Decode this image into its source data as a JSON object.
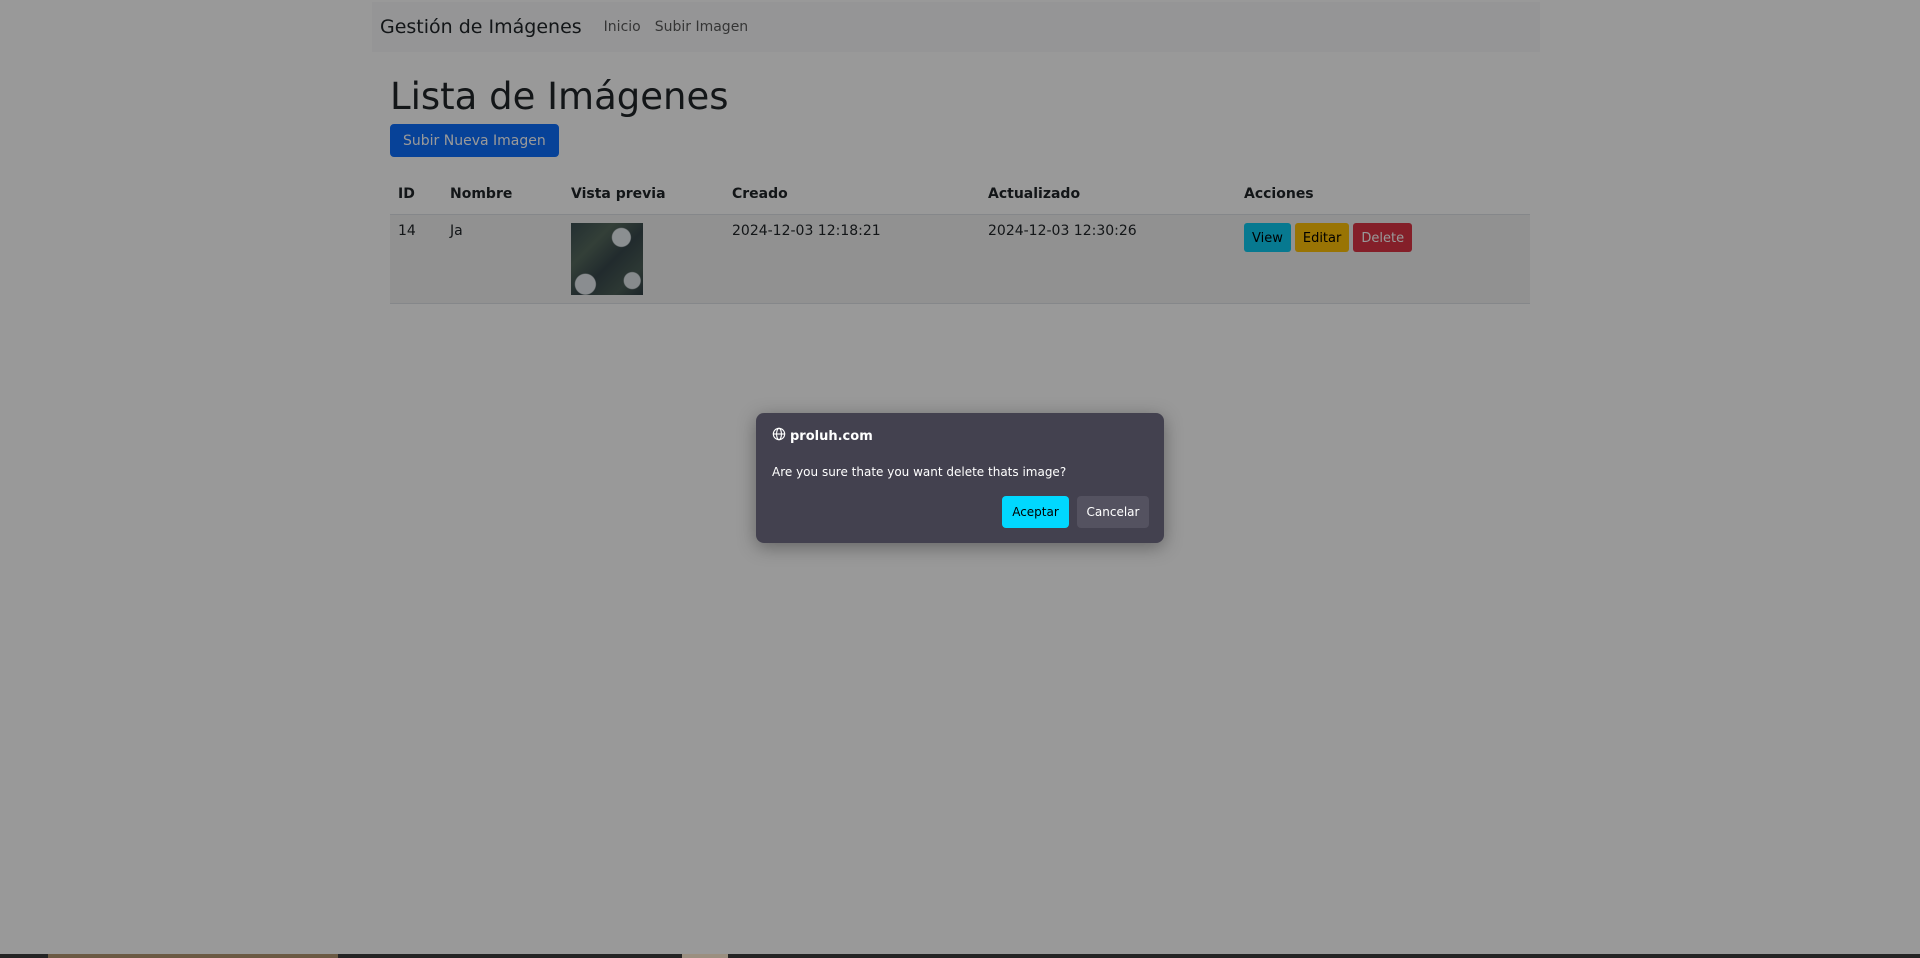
{
  "navbar": {
    "brand": "Gestión de Imágenes",
    "links": [
      "Inicio",
      "Subir Imagen"
    ]
  },
  "main": {
    "title": "Lista de Imágenes",
    "upload_button": "Subir Nueva Imagen",
    "table": {
      "headers": [
        "ID",
        "Nombre",
        "Vista previa",
        "Creado",
        "Actualizado",
        "Acciones"
      ],
      "rows": [
        {
          "id": "14",
          "name": "Ja",
          "created": "2024-12-03 12:18:21",
          "updated": "2024-12-03 12:30:26",
          "actions": [
            "View",
            "Editar",
            "Delete"
          ]
        }
      ]
    }
  },
  "dialog": {
    "origin": "proluh.com",
    "message": "Are you sure thate you want delete thats image?",
    "accept_label": "Aceptar",
    "cancel_label": "Cancelar"
  },
  "colors": {
    "primary": "#0d6efd",
    "info": "#0dcaf0",
    "warning": "#ffc107",
    "danger": "#dc3545",
    "dialog_bg": "#43414f",
    "accept": "#00d8ff"
  },
  "icons": {
    "dialog_origin": "globe-icon"
  }
}
